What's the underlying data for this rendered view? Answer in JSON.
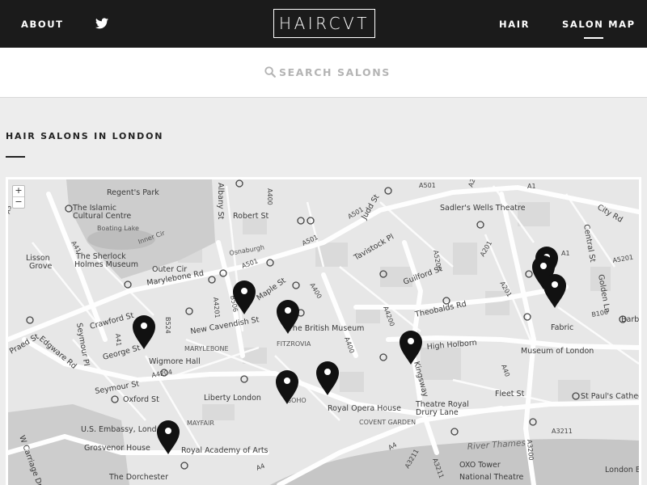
{
  "header": {
    "about_label": "ABOUT",
    "logo_text": "HAIRCVT",
    "hair_label": "HAIR",
    "salon_map_label": "SALON MAP"
  },
  "search": {
    "placeholder": "SEARCH SALONS"
  },
  "section": {
    "title": "HAIR SALONS IN LONDON"
  },
  "map": {
    "zoom_in": "+",
    "zoom_out": "−",
    "labels": {
      "regents_park": "Regent's Park",
      "islamic_1": "The Islamic",
      "islamic_2": "Cultural Centre",
      "boating_lake": "Boating Lake",
      "inner_cir": "Inner Cir",
      "outer_cir": "Outer Cir",
      "sherlock_1": "The Sherlock",
      "sherlock_2": "Holmes Museum",
      "lisson_1": "Lisson",
      "lisson_2": "Grove",
      "marylebone_rd": "Marylebone Rd",
      "crawford_st": "Crawford St",
      "seymour_pl": "Seymour Pl",
      "praed_st": "Praed St",
      "edgware_rd": "Edgware Rd",
      "george_st": "George St",
      "wigmore_hall": "Wigmore Hall",
      "marylebone": "MARYLEBONE",
      "new_cavendish": "New Cavendish St",
      "seymour_st": "Seymour St",
      "oxford_st": "Oxford St",
      "liberty": "Liberty London",
      "soho": "SOHO",
      "mayfair": "MAYFAIR",
      "us_embassy": "U.S. Embassy, London",
      "grosvenor": "Grosvenor House",
      "royal_academy": "Royal Academy of Arts",
      "dorchester": "The Dorchester",
      "carriage_dr": "W Carriage Dr",
      "albany_st": "Albany St",
      "robert_st": "Robert St",
      "osnaburgh": "Osnaburgh",
      "fitzrovia": "FITZROVIA",
      "british_museum": "The British Museum",
      "maple_st": "Maple St",
      "tavistock_pl": "Tavistock Pl",
      "judd_st": "Judd St",
      "guilford_st": "Guilford St",
      "sadlers": "Sadler's Wells Theatre",
      "city_rd": "City Rd",
      "central_st": "Central St",
      "golden_ln": "Golden Ln",
      "theobalds_rd": "Theobalds Rd",
      "high_holborn": "High Holborn",
      "museum_london": "Museum of London",
      "fabric": "Fabric",
      "barbican": "Barbi",
      "fleet_st": "Fleet St",
      "st_pauls": "St Paul's Cathedr",
      "royal_opera": "Royal Opera House",
      "theatre_royal_1": "Theatre Royal",
      "theatre_royal_2": "Drury Lane",
      "covent_garden": "COVENT GARDEN",
      "kingsway": "Kingsway",
      "river_thames": "River Thames",
      "oxo_tower": "OXO Tower",
      "national_theatre": "National Theatre",
      "london_bridge": "London Bri",
      "a41": "A41",
      "a501_1": "A501",
      "a501_2": "A501",
      "a501_3": "A501",
      "a501_4": "A501",
      "a400_1": "A400",
      "a400_2": "A400",
      "a400_3": "A400",
      "a4201": "A4201",
      "b506": "B506",
      "b524": "B524",
      "a4204": "A4204",
      "a4200": "A4200",
      "a5200": "A5200",
      "a201_1": "A201",
      "a201_2": "A201",
      "a201_3": "A201",
      "a5201": "A5201",
      "a1": "A1",
      "b100": "B100",
      "a40": "A40",
      "a4": "A4",
      "a3211_1": "A3211",
      "a3211_2": "A3211",
      "a3211_3": "A3211",
      "a3200": "A3200",
      "a5": "A5",
      "a1_2": "A1",
      "a4_2": "A4",
      "a41_2": "A41"
    }
  }
}
